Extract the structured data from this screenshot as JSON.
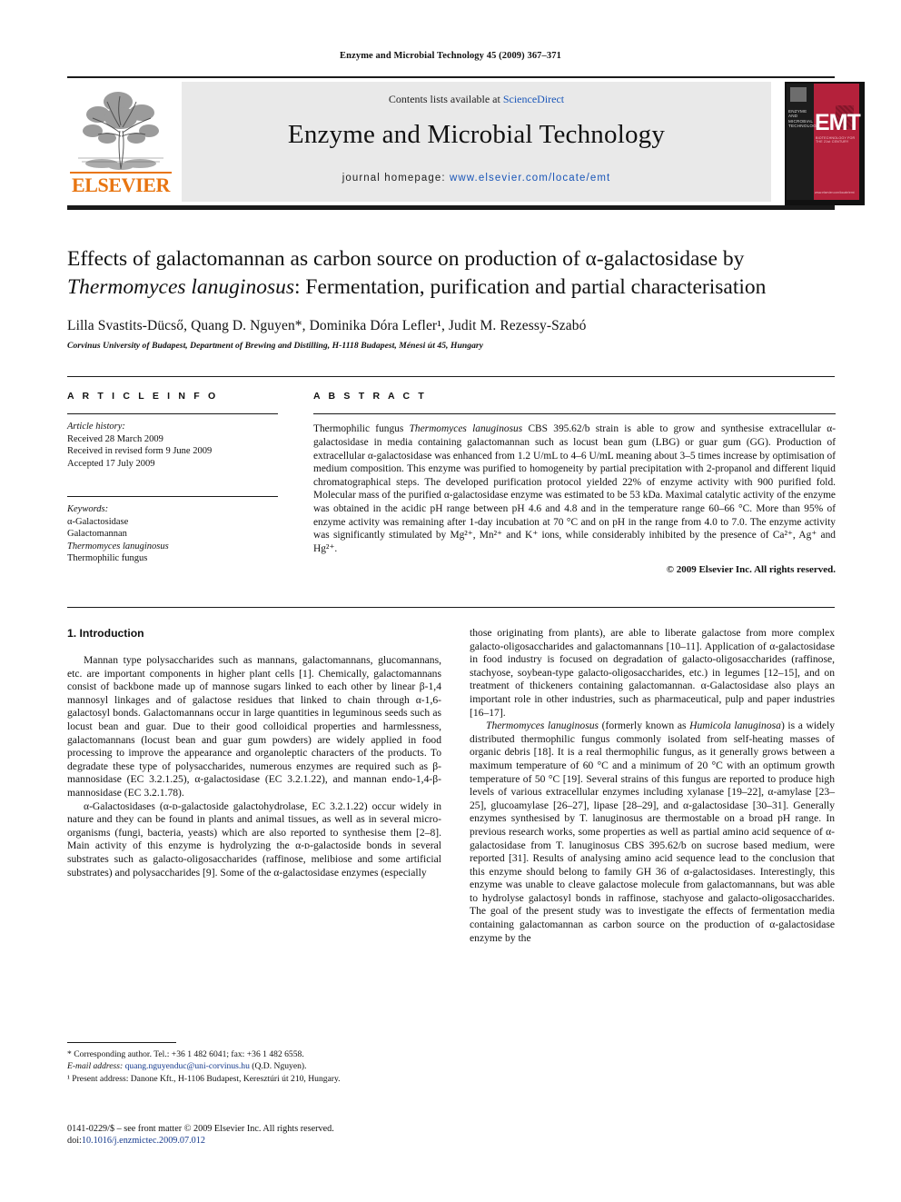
{
  "running_head": "Enzyme and Microbial Technology 45 (2009) 367–371",
  "masthead": {
    "contents_prefix": "Contents lists available at ",
    "contents_link": "ScienceDirect",
    "journal_title": "Enzyme and Microbial Technology",
    "homepage_prefix": "journal homepage: ",
    "homepage_url": "www.elsevier.com/locate/emt",
    "publisher_name": "ELSEVIER",
    "cover": {
      "journal_name_small": "ENZYME AND MICROBIAL TECHNOLOGY",
      "acronym": "EMT",
      "subtitle": "BIOTECHNOLOGY FOR THE 21st CENTURY",
      "footer_url": "www.elsevier.com/locate/emt"
    }
  },
  "article": {
    "title_line1": "Effects of galactomannan as carbon source on production of α-galactosidase by",
    "title_species": "Thermomyces lanuginosus",
    "title_line2_rest": ": Fermentation, purification and partial characterisation",
    "authors": "Lilla Svastits-Dücső, Quang D. Nguyen*, Dominika Dóra Lefler¹, Judit M. Rezessy-Szabó",
    "affiliation": "Corvinus University of Budapest, Department of Brewing and Distilling, H-1118 Budapest, Ménesi út 45, Hungary"
  },
  "article_info": {
    "heading": "A R T I C L E   I N F O",
    "history_label": "Article history:",
    "history": [
      "Received 28 March 2009",
      "Received in revised form 9 June 2009",
      "Accepted 17 July 2009"
    ],
    "keywords_label": "Keywords:",
    "keywords": [
      "α-Galactosidase",
      "Galactomannan",
      "Thermomyces lanuginosus",
      "Thermophilic fungus"
    ]
  },
  "abstract": {
    "heading": "A B S T R A C T",
    "part1": "Thermophilic fungus ",
    "species1": "Thermomyces lanuginosus",
    "part2": " CBS 395.62/b strain is able to grow and synthesise extracellular α-galactosidase in media containing galactomannan such as locust bean gum (LBG) or guar gum (GG). Production of extracellular α-galactosidase was enhanced from 1.2 U/mL to 4–6 U/mL meaning about 3–5 times increase by optimisation of medium composition. This enzyme was purified to homogeneity by partial precipitation with 2-propanol and different liquid chromatographical steps. The developed purification protocol yielded 22% of enzyme activity with 900 purified fold. Molecular mass of the purified α-galactosidase enzyme was estimated to be 53 kDa. Maximal catalytic activity of the enzyme was obtained in the acidic pH range between pH 4.6 and 4.8 and in the temperature range 60–66 °C. More than 95% of enzyme activity was remaining after 1-day incubation at 70 °C and on pH in the range from 4.0 to 7.0. The enzyme activity was significantly stimulated by Mg²⁺, Mn²⁺ and K⁺ ions, while considerably inhibited by the presence of Ca²⁺, Ag⁺ and Hg²⁺.",
    "copyright": "© 2009 Elsevier Inc. All rights reserved."
  },
  "intro": {
    "heading": "1.  Introduction",
    "left_p1": "Mannan type polysaccharides such as mannans, galactomannans, glucomannans, etc. are important components in higher plant cells [1]. Chemically, galactomannans consist of backbone made up of mannose sugars linked to each other by linear β-1,4 mannosyl linkages and of galactose residues that linked to chain through α-1,6-galactosyl bonds. Galactomannans occur in large quantities in leguminous seeds such as locust bean and guar. Due to their good colloidical properties and harmlessness, galactomannans (locust bean and guar gum powders) are widely applied in food processing to improve the appearance and organoleptic characters of the products. To degradate these type of polysaccharides, numerous enzymes are required such as β-mannosidase (EC 3.2.1.25), α-galactosidase (EC 3.2.1.22), and mannan endo-1,4-β-mannosidase (EC 3.2.1.78).",
    "left_p2": "α-Galactosidases (α-ᴅ-galactoside galactohydrolase, EC 3.2.1.22) occur widely in nature and they can be found in plants and animal tissues, as well as in several micro-organisms (fungi, bacteria, yeasts) which are also reported to synthesise them [2–8]. Main activity of this enzyme is hydrolyzing the α-ᴅ-galactoside bonds in several substrates such as galacto-oligosaccharides (raffinose, melibiose and some artificial substrates) and polysaccharides [9]. Some of the α-galactosidase enzymes (especially",
    "right_p1": "those originating from plants), are able to liberate galactose from more complex galacto-oligosaccharides and galactomannans [10–11]. Application of α-galactosidase in food industry is focused on degradation of galacto-oligosaccharides (raffinose, stachyose, soybean-type galacto-oligosaccharides, etc.) in legumes [12–15], and on treatment of thickeners containing galactomannan. α-Galactosidase also plays an important role in other industries, such as pharmaceutical, pulp and paper industries [16–17].",
    "right_p2_a": "",
    "right_p2": " (formerly known as ",
    "right_p2_species1": "Thermomyces lanuginosus",
    "right_p2_species2": "Humicola lanuginosa",
    "right_p2_rest": ") is a widely distributed thermophilic fungus commonly isolated from self-heating masses of organic debris [18]. It is a real thermophilic fungus, as it generally grows between a maximum temperature of 60 °C and a minimum of 20 °C with an optimum growth temperature of 50 °C [19]. Several strains of this fungus are reported to produce high levels of various extracellular enzymes including xylanase [19–22], α-amylase [23–25], glucoamylase [26–27], lipase [28–29], and α-galactosidase [30–31]. Generally enzymes synthesised by T. lanuginosus are thermostable on a broad pH range. In previous research works, some properties as well as partial amino acid sequence of α-galactosidase from T. lanuginosus CBS 395.62/b on sucrose based medium, were reported [31]. Results of analysing amino acid sequence lead to the conclusion that this enzyme should belong to family GH 36 of α-galactosidases. Interestingly, this enzyme was unable to cleave galactose molecule from galactomannans, but was able to hydrolyse galactosyl bonds in raffinose, stachyose and galacto-oligosaccharides. The goal of the present study was to investigate the effects of fermentation media containing galactomannan as carbon source on the production of α-galactosidase enzyme by the"
  },
  "footnotes": {
    "corresponding": "* Corresponding author. Tel.: +36 1 482 6041; fax: +36 1 482 6558.",
    "email_label": "E-mail address: ",
    "email": "quang.nguyenduc@uni-corvinus.hu",
    "email_suffix": " (Q.D. Nguyen).",
    "present_address": "¹ Present address: Danone Kft., H-1106 Budapest, Keresztúri út 210, Hungary."
  },
  "imprint": {
    "line1": "0141-0229/$ – see front matter © 2009 Elsevier Inc. All rights reserved.",
    "doi_label": "doi:",
    "doi": "10.1016/j.enzmictec.2009.07.012"
  }
}
